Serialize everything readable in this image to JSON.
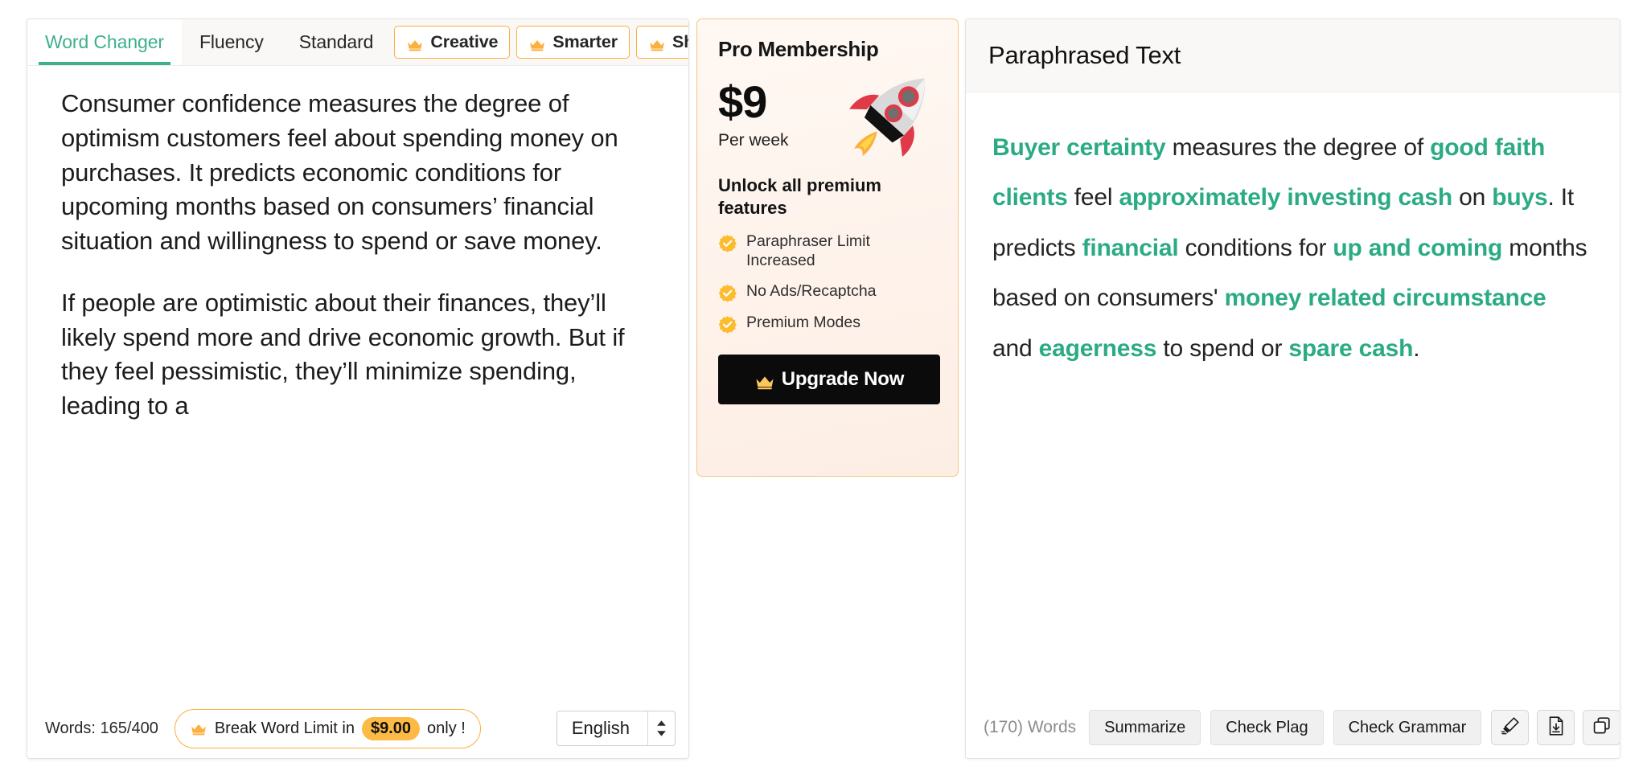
{
  "left_panel": {
    "tabs": [
      {
        "label": "Word Changer",
        "active": true,
        "pro": false
      },
      {
        "label": "Fluency",
        "active": false,
        "pro": false
      },
      {
        "label": "Standard",
        "active": false,
        "pro": false
      },
      {
        "label": "Creative",
        "active": false,
        "pro": true
      },
      {
        "label": "Smarter",
        "active": false,
        "pro": true
      },
      {
        "label": "Shorten",
        "active": false,
        "pro": true
      }
    ],
    "source_paragraphs": [
      "Consumer confidence measures the degree of optimism customers feel about spending money on purchases. It predicts economic conditions for upcoming months based on consumers’ financial situation and willingness to spend or save money.",
      "If people are optimistic about their finances, they’ll likely spend more and drive economic growth. But if they feel pessimistic, they’ll minimize spending, leading to a"
    ],
    "footer": {
      "word_count": "Words: 165/400",
      "break_limit_prefix": "Break Word Limit in",
      "break_limit_price": "$9.00",
      "break_limit_suffix": "only !",
      "language": "English"
    }
  },
  "pro_card": {
    "title": "Pro Membership",
    "price": "$9",
    "price_period": "Per week",
    "unlock_heading": "Unlock all premium features",
    "features": [
      "Paraphraser Limit Increased",
      "No Ads/Recaptcha",
      "Premium Modes"
    ],
    "upgrade_label": "Upgrade Now"
  },
  "right_panel": {
    "title": "Paraphrased Text",
    "paraphrased_runs": [
      {
        "text": "Buyer certainty",
        "highlight": true
      },
      {
        "text": " measures the degree of ",
        "highlight": false
      },
      {
        "text": "good faith clients",
        "highlight": true
      },
      {
        "text": " feel ",
        "highlight": false
      },
      {
        "text": "approximately investing cash",
        "highlight": true
      },
      {
        "text": " on ",
        "highlight": false
      },
      {
        "text": "buys",
        "highlight": true
      },
      {
        "text": ". It predicts ",
        "highlight": false
      },
      {
        "text": "financial",
        "highlight": true
      },
      {
        "text": " conditions for ",
        "highlight": false
      },
      {
        "text": "up and coming",
        "highlight": true
      },
      {
        "text": " months based on consumers' ",
        "highlight": false
      },
      {
        "text": "money related circumstance",
        "highlight": true
      },
      {
        "text": " and ",
        "highlight": false
      },
      {
        "text": "eagerness",
        "highlight": true
      },
      {
        "text": " to spend or ",
        "highlight": false
      },
      {
        "text": "spare cash",
        "highlight": true
      },
      {
        "text": ".",
        "highlight": false
      }
    ],
    "footer": {
      "word_count": "(170) Words",
      "buttons": [
        "Summarize",
        "Check Plag",
        "Check Grammar"
      ],
      "icons": [
        "highlighter-icon",
        "download-file-icon",
        "copy-icon"
      ]
    }
  },
  "colors": {
    "accent_green": "#3cb08d",
    "highlight_green": "#2bab84",
    "pro_orange": "#fbb03f",
    "price_pill": "#fdba45",
    "dark_button": "#0b0b0b"
  }
}
